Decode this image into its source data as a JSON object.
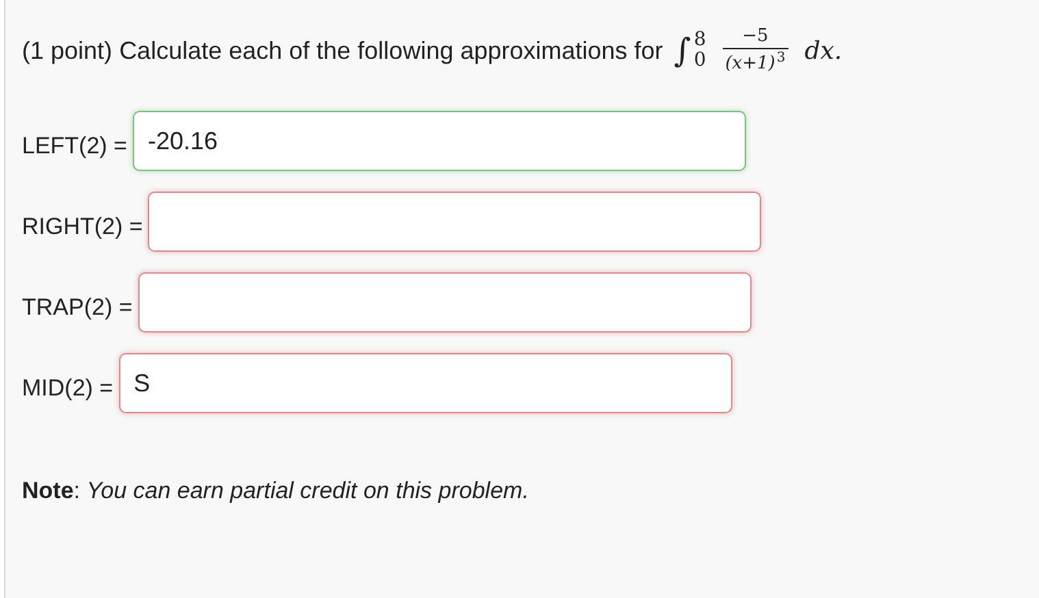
{
  "problem": {
    "points": "(1 point)",
    "prompt": "Calculate each of the following approximations for",
    "integral": {
      "sign": "∫",
      "lower": "0",
      "upper": "8",
      "numerator": "−5",
      "denominator": "(x+1)",
      "exponent": "3",
      "differential": "dx."
    }
  },
  "answers": [
    {
      "label": "LEFT(2) =",
      "value": "-20.16",
      "correct": true
    },
    {
      "label": "RIGHT(2) =",
      "correct": false
    },
    {
      "label": "TRAP(2) =",
      "correct": false
    },
    {
      "label": "MID(2) =",
      "value": "S",
      "correct": false
    }
  ],
  "note": "**Note**: *You can earn partial credit on this problem.*"
}
